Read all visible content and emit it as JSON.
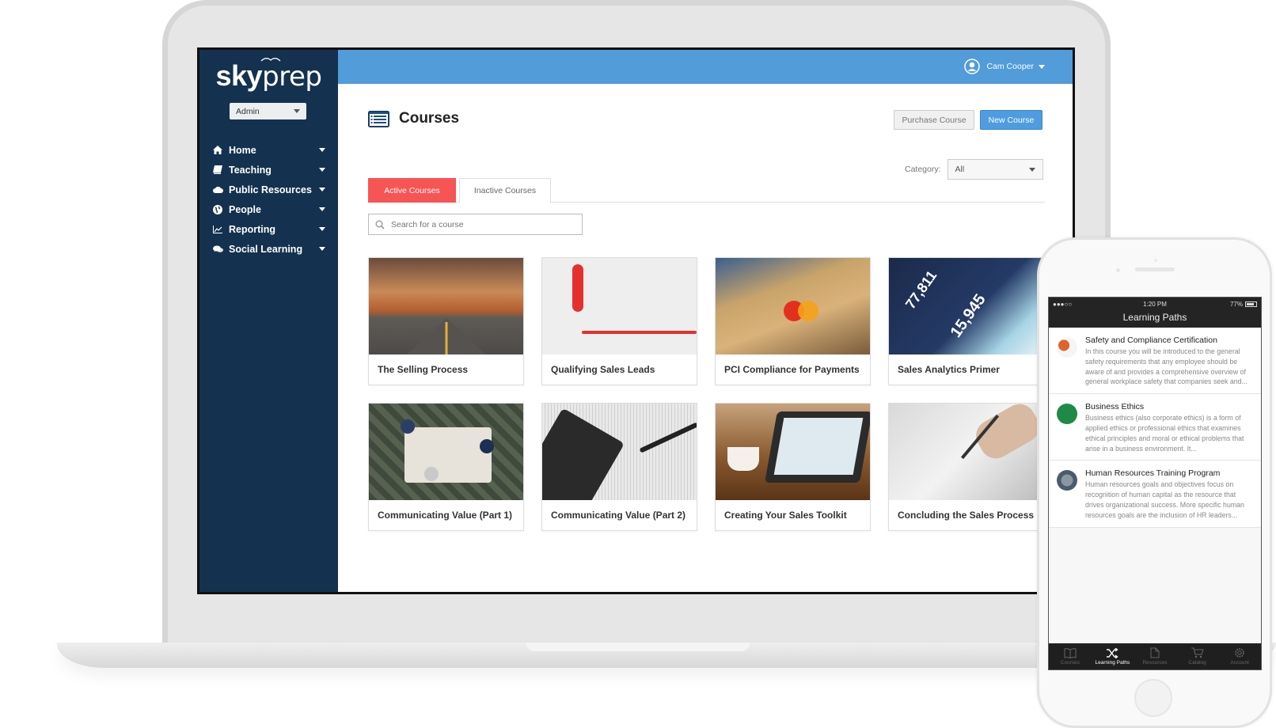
{
  "app": {
    "brand_bold": "sky",
    "brand_light": "prep",
    "role_select": "Admin"
  },
  "sidebar": {
    "items": [
      {
        "label": "Home",
        "icon": "home-icon"
      },
      {
        "label": "Teaching",
        "icon": "book-icon"
      },
      {
        "label": "Public Resources",
        "icon": "cloud-icon"
      },
      {
        "label": "People",
        "icon": "globe-icon"
      },
      {
        "label": "Reporting",
        "icon": "line-chart-icon"
      },
      {
        "label": "Social Learning",
        "icon": "chat-icon"
      }
    ]
  },
  "header": {
    "user_name": "Cam Cooper"
  },
  "main": {
    "title": "Courses",
    "purchase_label": "Purchase Course",
    "new_label": "New Course",
    "category_label": "Category:",
    "category_value": "All",
    "tabs": [
      {
        "label": "Active Courses",
        "active": true
      },
      {
        "label": "Inactive Courses",
        "active": false
      }
    ],
    "search_placeholder": "Search for a course",
    "courses": [
      {
        "title": "The Selling Process",
        "image": "desert-road"
      },
      {
        "title": "Qualifying Sales Leads",
        "image": "red-telephone"
      },
      {
        "title": "PCI Compliance for Payments",
        "image": "credit-cards"
      },
      {
        "title": "Sales Analytics Primer",
        "image": "analytics-screen"
      },
      {
        "title": "Communicating Value (Part 1)",
        "image": "meeting-overhead"
      },
      {
        "title": "Communicating Value (Part 2)",
        "image": "calculator-pen"
      },
      {
        "title": "Creating Your Sales Toolkit",
        "image": "tablet-coffee"
      },
      {
        "title": "Concluding the Sales Process",
        "image": "signing-document"
      }
    ]
  },
  "phone": {
    "carrier": "●●●○○",
    "time": "1:20 PM",
    "battery": "77%",
    "nav_title": "Learning Paths",
    "paths": [
      {
        "title": "Safety and Compliance Certification",
        "description": "In this course you will be introduced to the general safety requirements that any employee should be aware of and provides a comprehensive overview of general workplace safety that companies seek and...",
        "accent": "#e0632b"
      },
      {
        "title": "Business Ethics",
        "description": "Business ethics (also corporate ethics) is a form of applied ethics or professional ethics that examines ethical principles and moral or ethical problems that arise in a business environment. It...",
        "accent": "#1e8a45"
      },
      {
        "title": "Human Resources Training Program",
        "description": "Human resources goals and objectives focus on recognition of human capital as the resource that drives organizational success.  More specific human resources goals are the inclusion of HR leaders...",
        "accent": "#5a6f80"
      }
    ],
    "tabs": [
      {
        "label": "Courses",
        "active": false
      },
      {
        "label": "Learning Paths",
        "active": true
      },
      {
        "label": "Resources",
        "active": false
      },
      {
        "label": "Catalog",
        "active": false
      },
      {
        "label": "Account",
        "active": false
      }
    ]
  },
  "colors": {
    "sidebar": "#14324f",
    "topbar": "#519cd9",
    "primary_button": "#4f9ce0",
    "active_tab": "#f75454"
  }
}
